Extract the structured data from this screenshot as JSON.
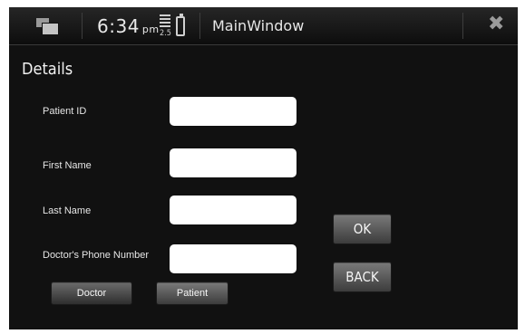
{
  "statusbar": {
    "time": "6:34",
    "ampm": "pm",
    "signal_value": "2.5",
    "window_title": "MainWindow"
  },
  "form": {
    "heading": "Details",
    "fields": [
      {
        "label": "Patient ID",
        "value": ""
      },
      {
        "label": "First Name",
        "value": ""
      },
      {
        "label": "Last Name",
        "value": ""
      },
      {
        "label": "Doctor's Phone Number",
        "value": ""
      }
    ]
  },
  "buttons": {
    "ok": "OK",
    "back": "BACK",
    "doctor": "Doctor",
    "patient": "Patient"
  }
}
